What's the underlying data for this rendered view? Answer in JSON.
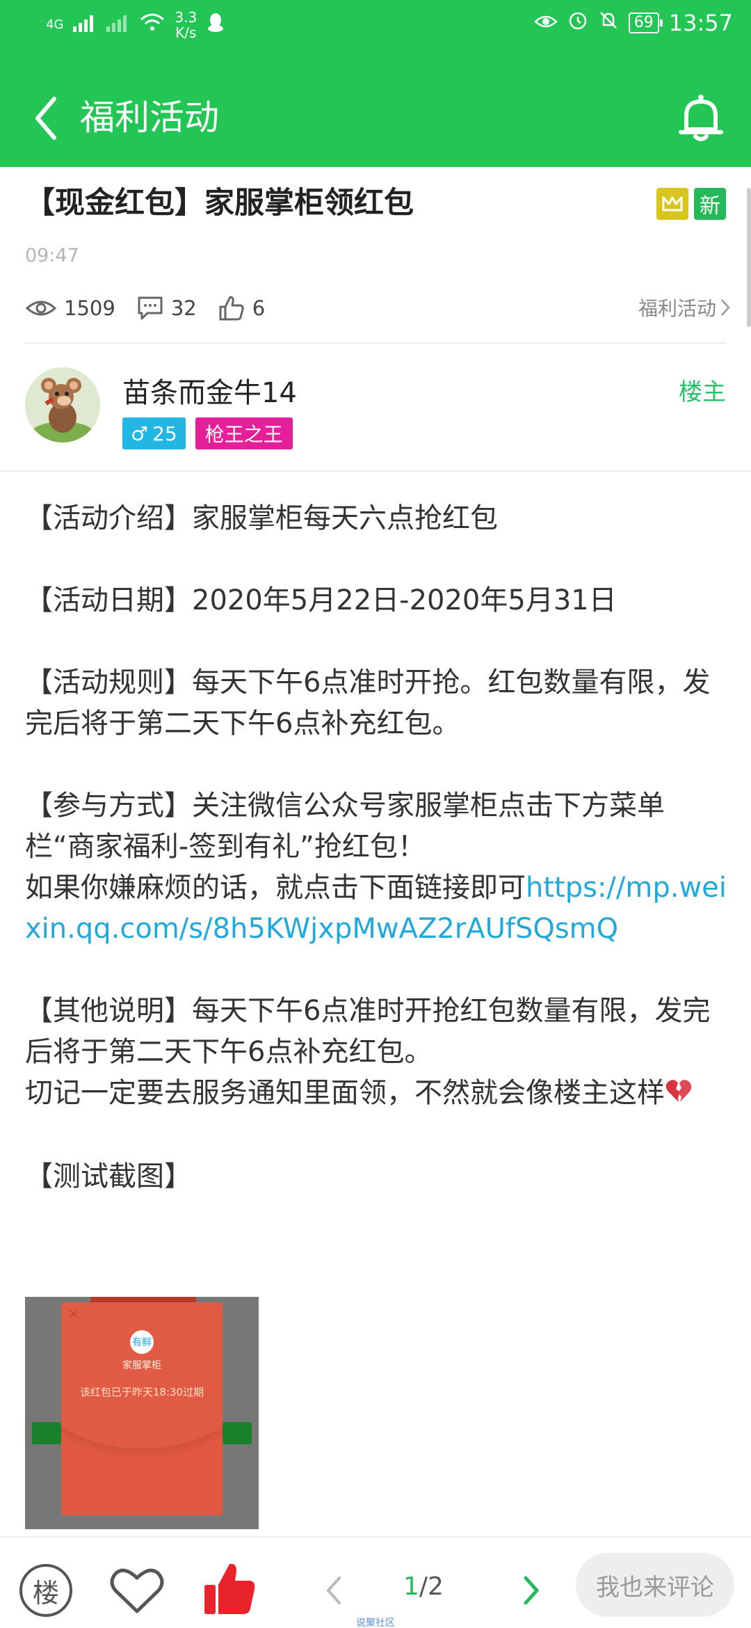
{
  "status_bar": {
    "network": "4G",
    "speed_value": "3.3",
    "speed_unit": "K/s",
    "battery": "69",
    "time": "13:57"
  },
  "app_bar": {
    "title": "福利活动"
  },
  "post": {
    "title": "【现金红包】家服掌柜领红包",
    "badge_new": "新",
    "time": "09:47",
    "views": "1509",
    "comments": "32",
    "likes": "6",
    "category": "福利活动"
  },
  "author": {
    "name": "苗条而金牛14",
    "gender_symbol": "♂",
    "level": "25",
    "title_tag": "枪王之王",
    "op_label": "楼主"
  },
  "content": {
    "intro": "【活动介绍】家服掌柜每天六点抢红包",
    "date": "【活动日期】2020年5月22日-2020年5月31日",
    "rules": "【活动规则】每天下午6点准时开抢。红包数量有限，发完后将于第二天下午6点补充红包。",
    "participate": "【参与方式】关注微信公众号家服掌柜点击下方菜单栏“商家福利-签到有礼”抢红包！",
    "lazy_line": "如果你嫌麻烦的话，就点击下面链接即可",
    "link_url": "https://mp.weixin.qq.com/s/8h5KWjxpMwAZ2rAUfSQsmQ",
    "other": "【其他说明】每天下午6点准时开抢红包数量有限，发完后将于第二天下午6点补充红包。",
    "reminder": "切记一定要去服务通知里面领，不然就会像楼主这样",
    "screenshot_heading": "【测试截图】"
  },
  "thumbnail": {
    "logo_text": "有鲜",
    "brand": "家服掌柜",
    "message": "该红包已于昨天18:30过期",
    "close": "×"
  },
  "bottom_bar": {
    "floor_label": "楼",
    "page_current": "1",
    "page_total": "/2",
    "comment_placeholder": "我也来评论"
  },
  "watermark": "说聚社区",
  "colors": {
    "primary_green": "#23c654",
    "link_blue": "#21a9dc",
    "like_red": "#e8232a",
    "tag_pink": "#e51f9a",
    "tag_blue": "#22b6e4"
  }
}
